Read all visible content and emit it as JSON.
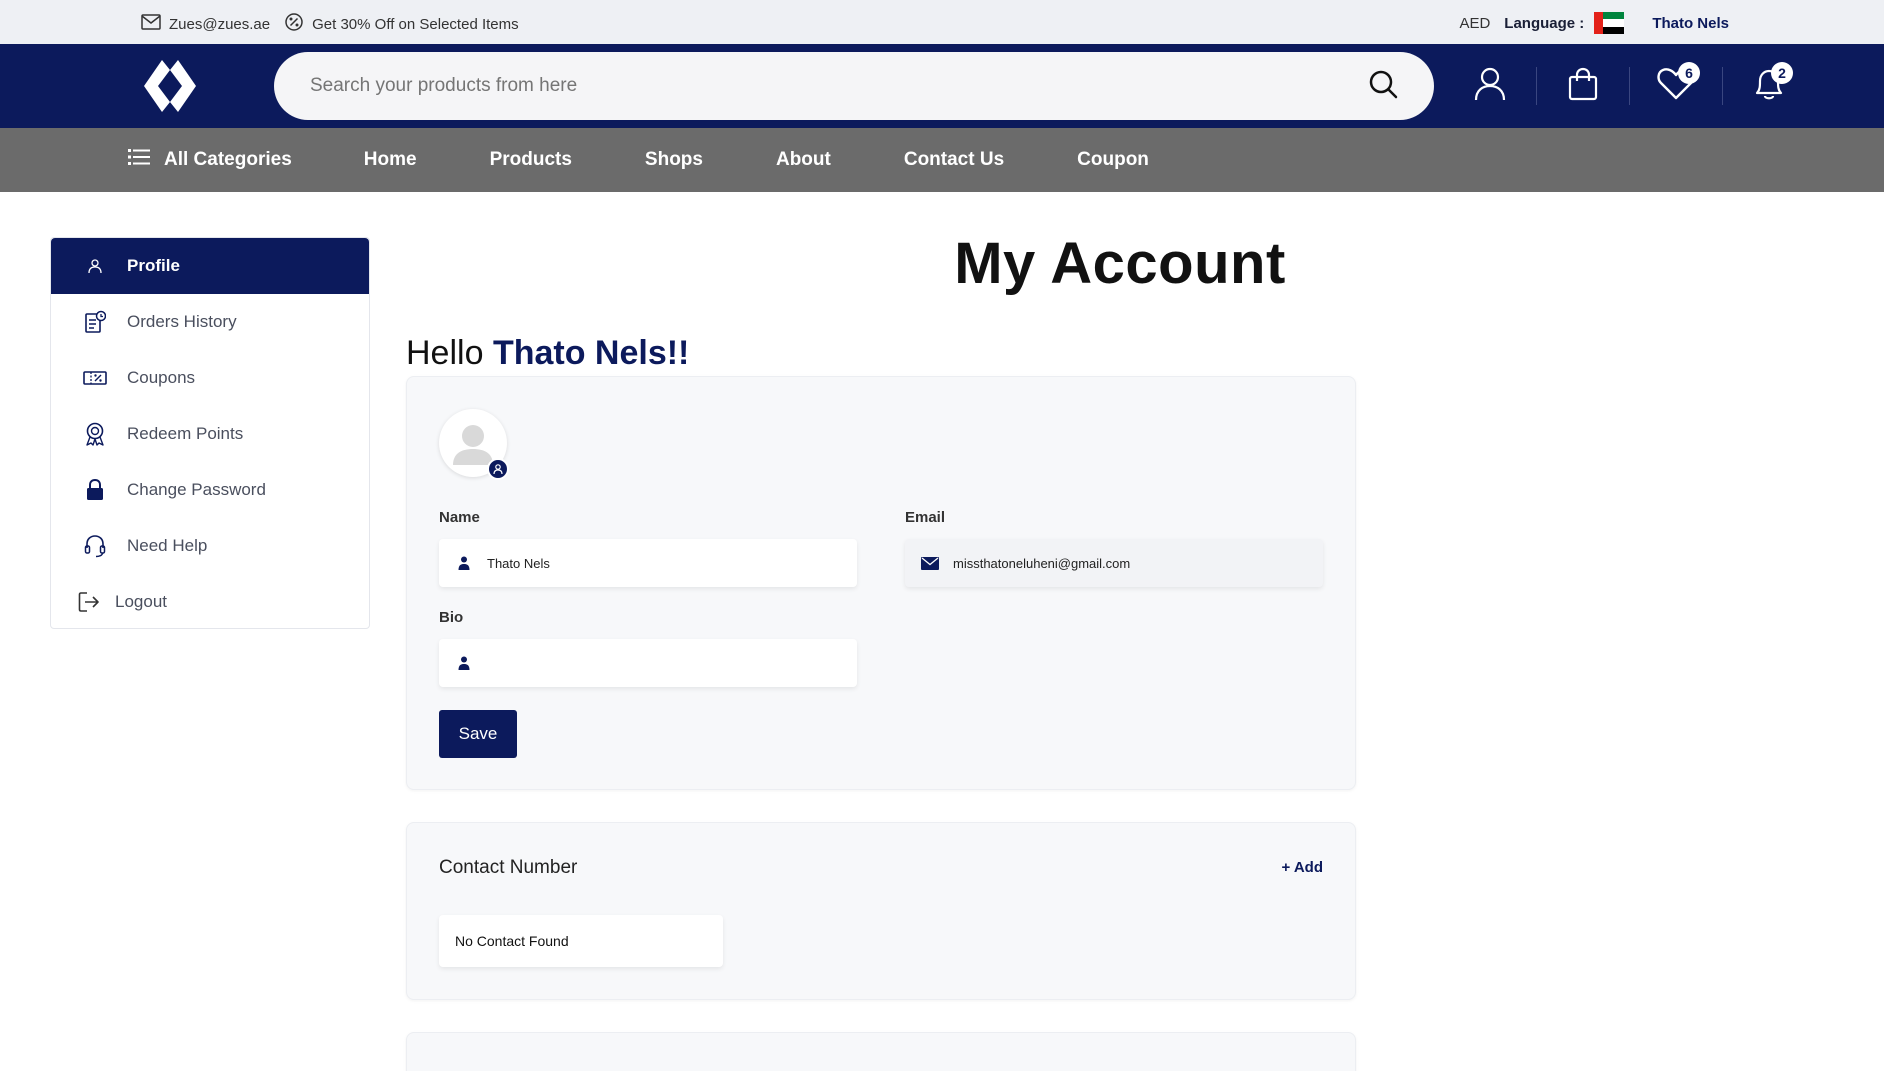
{
  "topbar": {
    "email": "Zues@zues.ae",
    "promo": "Get 30% Off on Selected Items",
    "currency": "AED",
    "language_label": "Language :",
    "user_name": "Thato Nels"
  },
  "header": {
    "search_placeholder": "Search your products from here",
    "wishlist_count": "6",
    "notifications_count": "2"
  },
  "nav": {
    "categories": "All Categories",
    "links": [
      "Home",
      "Products",
      "Shops",
      "About",
      "Contact Us",
      "Coupon"
    ]
  },
  "sidebar": {
    "items": [
      {
        "label": "Profile",
        "icon": "user-icon"
      },
      {
        "label": "Orders History",
        "icon": "orders-icon"
      },
      {
        "label": "Coupons",
        "icon": "coupon-icon"
      },
      {
        "label": "Redeem Points",
        "icon": "award-icon"
      },
      {
        "label": "Change Password",
        "icon": "lock-icon"
      },
      {
        "label": "Need Help",
        "icon": "headset-icon"
      },
      {
        "label": "Logout",
        "icon": "logout-icon"
      }
    ]
  },
  "main": {
    "title": "My Account",
    "hello_prefix": "Hello",
    "hello_name": "Thato Nels!!",
    "profile": {
      "name_label": "Name",
      "name_value": "Thato Nels",
      "email_label": "Email",
      "email_value": "missthatoneluheni@gmail.com",
      "bio_label": "Bio",
      "bio_value": "",
      "save_label": "Save"
    },
    "contact": {
      "title": "Contact Number",
      "add_label": "+ Add",
      "empty_text": "No Contact Found"
    }
  },
  "colors": {
    "brand": "#0c1a5c",
    "nav_bg": "#6b6b6b",
    "top_strip": "#eef0f4"
  }
}
